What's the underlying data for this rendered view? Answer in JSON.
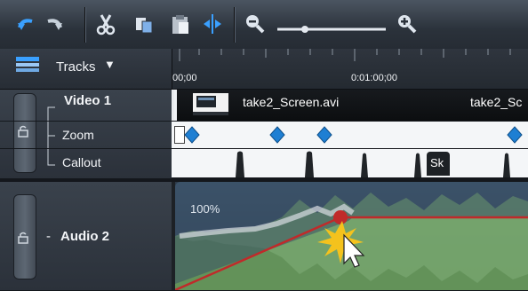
{
  "toolbar": {
    "icons": [
      "undo-icon",
      "redo-icon",
      "cut-icon",
      "copy-icon",
      "paste-icon",
      "split-icon",
      "zoom-out-icon",
      "zoom-slider",
      "zoom-in-icon"
    ]
  },
  "header": {
    "tracks_label": "Tracks",
    "dropdown_glyph": "▼",
    "timecodes": [
      "00;00",
      "0:01:00;00"
    ]
  },
  "tracks": [
    {
      "name": "Video 1",
      "prefix": "-"
    },
    {
      "name": "Zoom",
      "prefix": "-"
    },
    {
      "name": "Callout",
      "prefix": "└"
    },
    {
      "name": "Audio 2",
      "prefix": "-"
    }
  ],
  "video_clips": [
    {
      "label": "take2_Screen.avi"
    },
    {
      "label": "take2_Sc"
    }
  ],
  "callout_clip": {
    "label": "Sk"
  },
  "audio": {
    "volume_label": "100%"
  },
  "colors": {
    "accent_blue": "#1e7fd3",
    "audio_green": "#7fb36f",
    "volume_line": "#c02a2a"
  }
}
